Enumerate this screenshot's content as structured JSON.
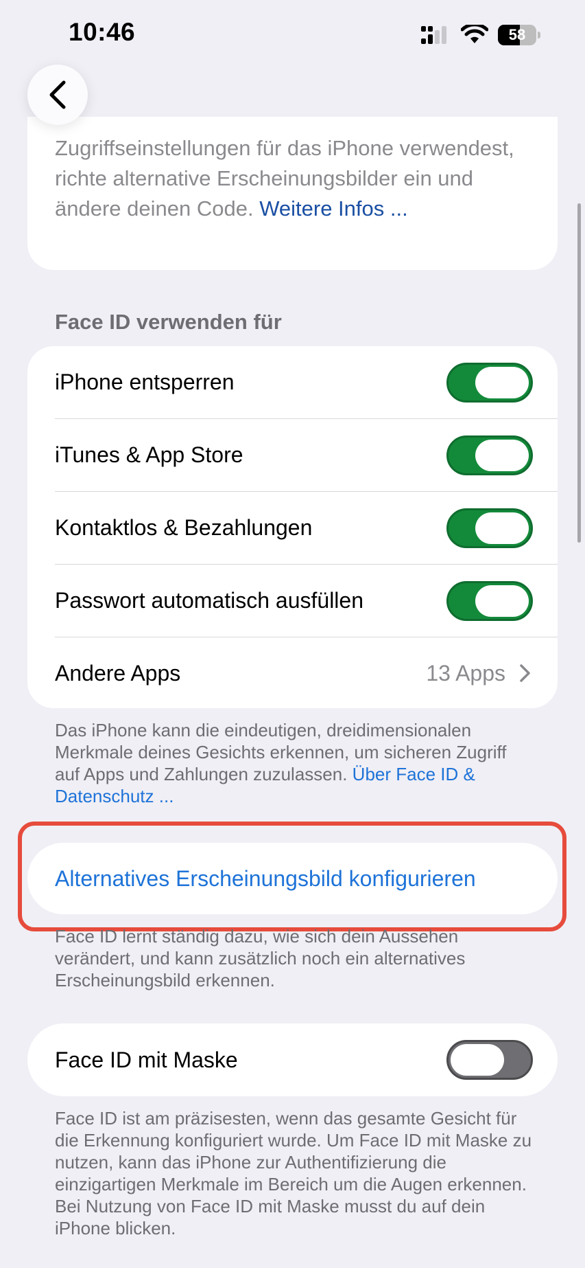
{
  "status_bar": {
    "time": "10:46",
    "battery_percent": "58",
    "battery_level": 0.58
  },
  "intro": {
    "text": "Zugriffseinstellungen für das iPhone verwendest, richte alternative Erscheinungsbilder ein und ändere deinen Code.",
    "link": "Weitere Infos ..."
  },
  "face_id": {
    "section_title": "Face ID verwenden für",
    "rows": [
      {
        "label": "iPhone entsperren",
        "on": true
      },
      {
        "label": "iTunes & App Store",
        "on": true
      },
      {
        "label": "Kontaktlos & Bezahlungen",
        "on": true
      },
      {
        "label": "Passwort automatisch ausfüllen",
        "on": true
      }
    ],
    "other_apps": {
      "label": "Andere Apps",
      "value": "13 Apps"
    },
    "footer_text": "Das iPhone kann die eindeutigen, dreidimensionalen Merkmale deines Gesichts erkennen, um sicheren Zugriff auf Apps und Zahlungen zuzulassen.",
    "footer_link": "Über Face ID & Datenschutz ..."
  },
  "alternative": {
    "button_label": "Alternatives Erscheinungsbild konfigurieren",
    "footer_text": "Face ID lernt ständig dazu, wie sich dein Aussehen verändert, und kann zusätzlich noch ein alternatives Erscheinungsbild erkennen."
  },
  "mask": {
    "label": "Face ID mit Maske",
    "on": false,
    "footer_text": "Face ID ist am präzisesten, wenn das gesamte Gesicht für die Erkennung konfiguriert wurde. Um Face ID mit Maske zu nutzen, kann das iPhone zur Authentifizierung die einzigartigen Merkmale im Bereich um die Augen erkennen. Bei Nutzung von Face ID mit Maske musst du auf dein iPhone blicken."
  },
  "colors": {
    "toggle_on": "#138a3a",
    "toggle_off": "#6f6f73",
    "link_blue": "#1e73d8",
    "highlight_red": "#e64b3c"
  }
}
